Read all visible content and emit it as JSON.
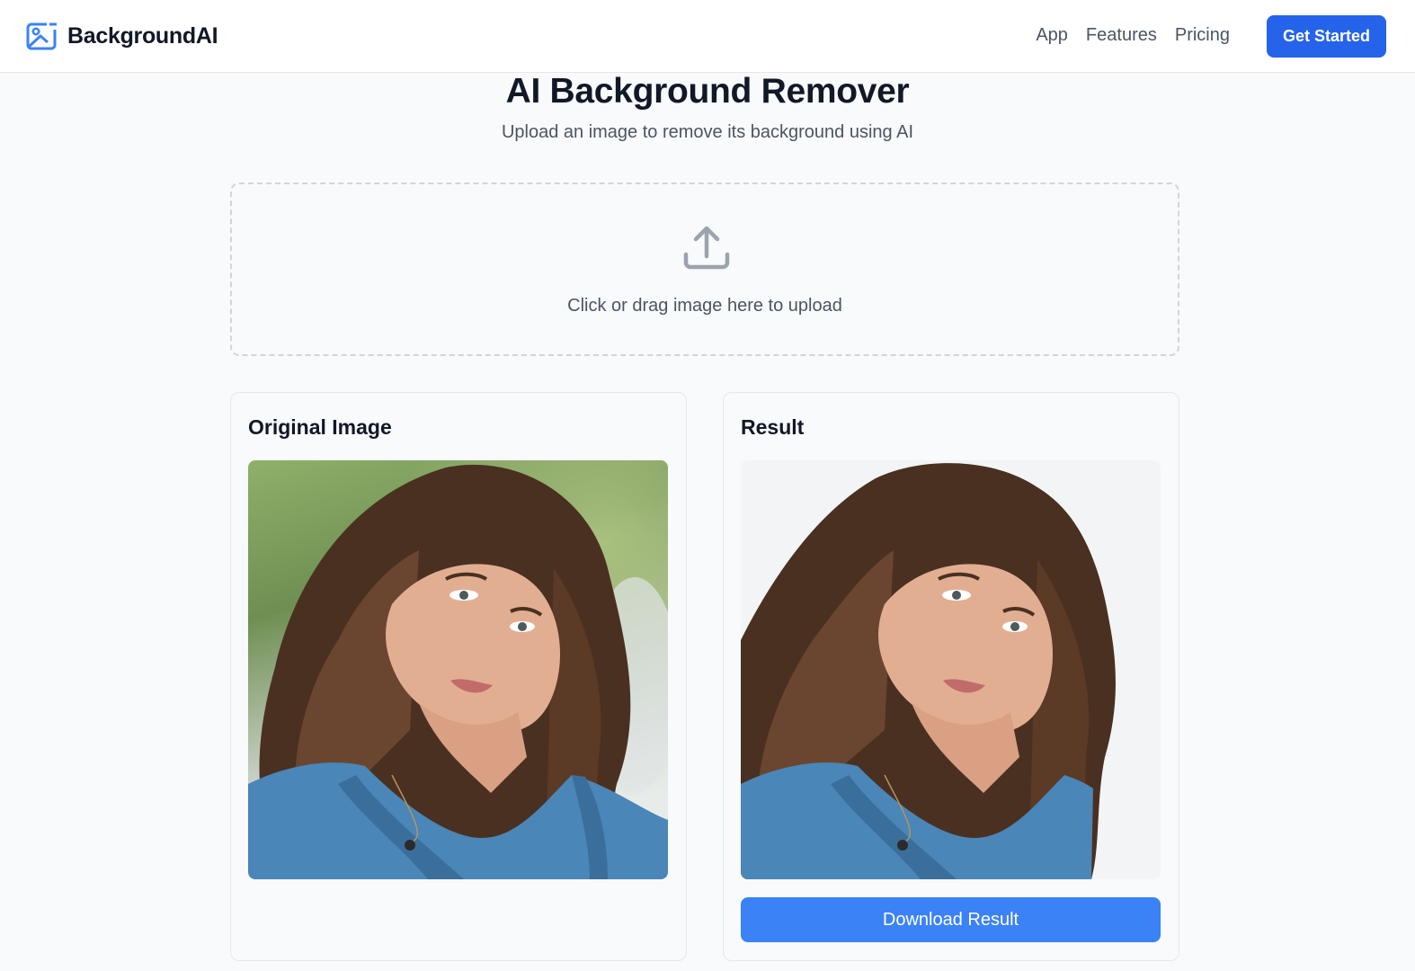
{
  "brand": {
    "name": "BackgroundAI",
    "icon": "image-icon"
  },
  "nav": {
    "links": [
      "App",
      "Features",
      "Pricing"
    ],
    "cta_label": "Get Started"
  },
  "hero": {
    "title": "AI Background Remover",
    "subtitle": "Upload an image to remove its background using AI"
  },
  "upload": {
    "icon": "upload-icon",
    "text": "Click or drag image here to upload"
  },
  "original": {
    "title": "Original Image"
  },
  "result": {
    "title": "Result",
    "download_label": "Download Result"
  },
  "colors": {
    "accent": "#2563eb",
    "download_button": "#3b82f6",
    "page_background": "#f9fafb",
    "result_background": "#f3f4f6"
  }
}
